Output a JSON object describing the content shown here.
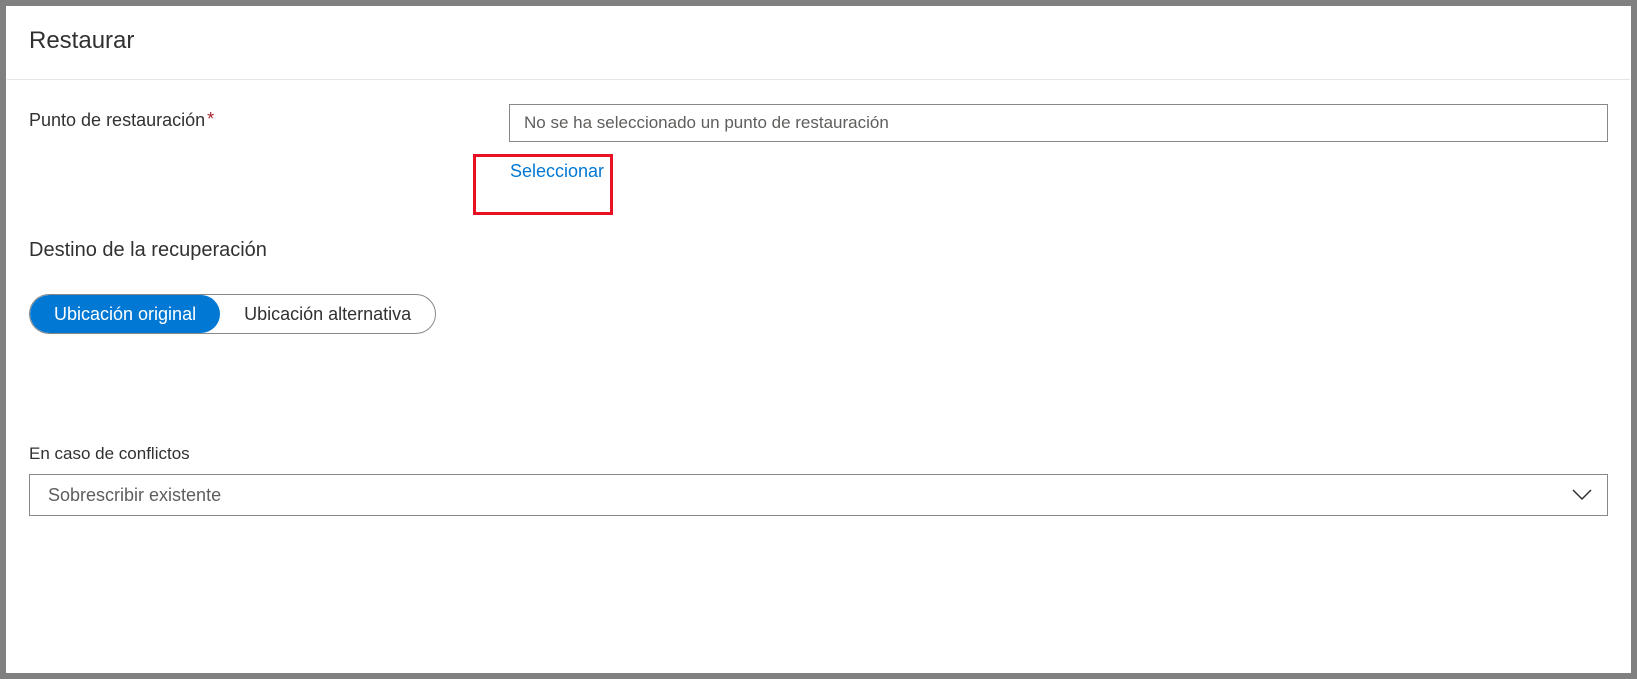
{
  "header": {
    "title": "Restaurar"
  },
  "restore_point": {
    "label": "Punto de restauración",
    "required_marker": "*",
    "placeholder": "No se ha seleccionado un punto de restauración",
    "select_link": "Seleccionar"
  },
  "destination": {
    "title": "Destino de la recuperación",
    "options": {
      "original": "Ubicación original",
      "alternate": "Ubicación alternativa"
    }
  },
  "conflicts": {
    "label": "En caso de conflictos",
    "selected": "Sobrescribir existente"
  }
}
